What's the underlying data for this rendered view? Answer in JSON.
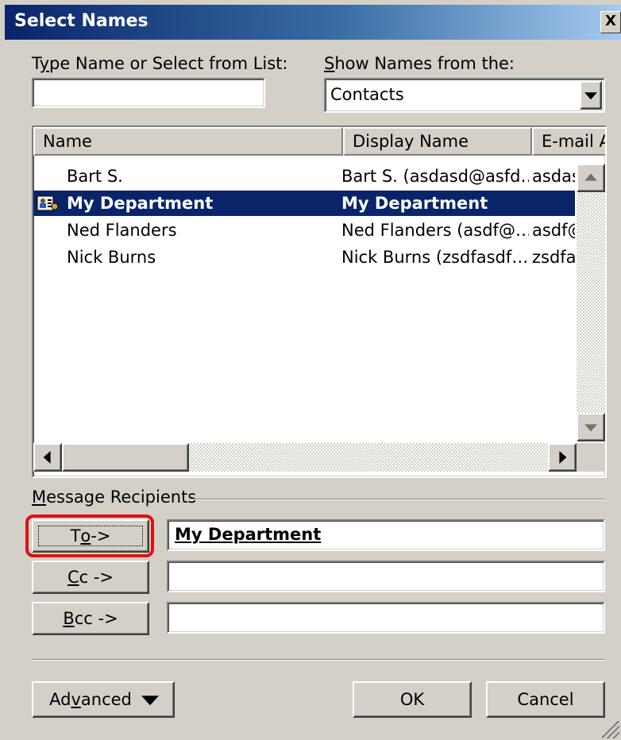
{
  "window": {
    "title": "Select Names",
    "close_glyph": "X"
  },
  "search": {
    "label_pre": "T",
    "label_acc": "y",
    "label_post": "pe Name or Select from List:",
    "value": ""
  },
  "show_names": {
    "label_acc": "S",
    "label_post": "how Names from the:",
    "selected": "Contacts"
  },
  "list": {
    "columns": [
      "Name",
      "Display Name",
      "E-mail A"
    ],
    "rows": [
      {
        "name": "Bart S.",
        "display": "Bart S. (asdasd@asfd…",
        "email": "asdas"
      },
      {
        "name": "My Department",
        "display": "My Department",
        "email": "",
        "selected": true,
        "icon": "contact-group-icon"
      },
      {
        "name": "Ned Flanders",
        "display": "Ned Flanders (asdf@…",
        "email": "asdf@"
      },
      {
        "name": "Nick Burns",
        "display": "Nick Burns (zsdfasdf…",
        "email": "zsdfa:"
      }
    ]
  },
  "recipients": {
    "group_label_acc": "M",
    "group_label_post": "essage Recipients",
    "to": {
      "pre": "T",
      "acc": "o",
      "post": " ->",
      "value": "My Department"
    },
    "cc": {
      "acc": "C",
      "post": "c ->",
      "value": ""
    },
    "bcc": {
      "acc": "B",
      "post": "cc ->",
      "value": ""
    }
  },
  "buttons": {
    "advanced_pre": "Ad",
    "advanced_acc": "v",
    "advanced_post": "anced",
    "ok": "OK",
    "cancel": "Cancel"
  },
  "colors": {
    "selection": "#0a246a",
    "highlight_ring": "#e01010"
  }
}
